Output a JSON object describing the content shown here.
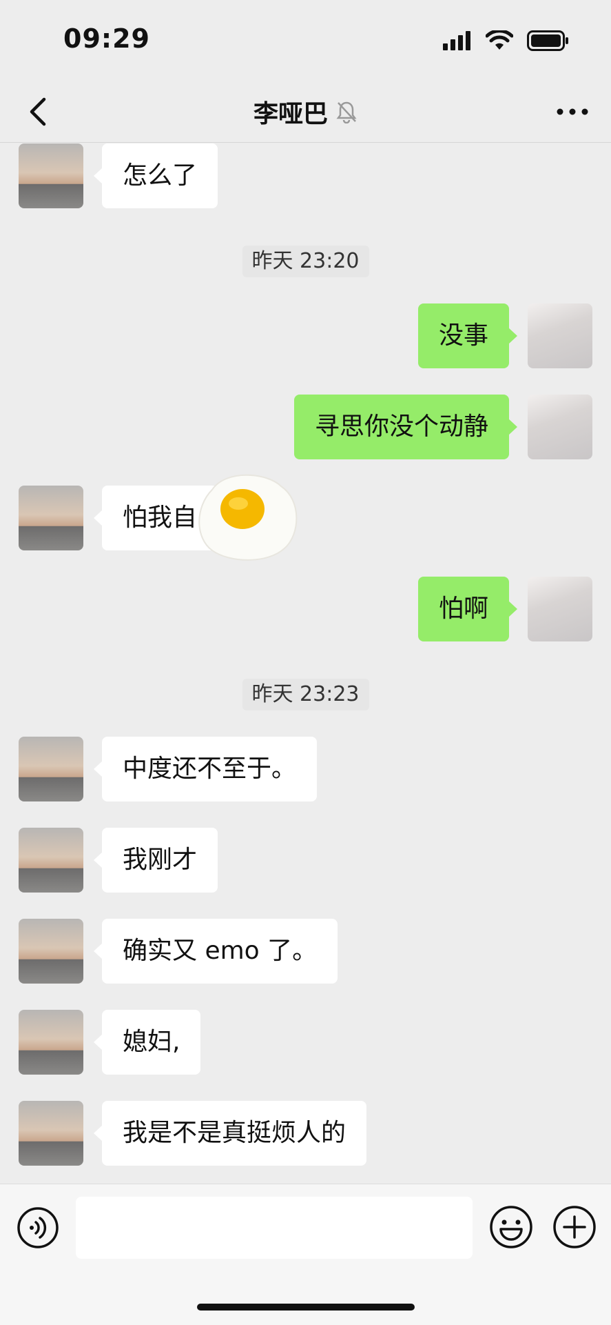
{
  "status_bar": {
    "time": "09:29",
    "icons": [
      "signal-icon",
      "wifi-icon",
      "battery-icon"
    ]
  },
  "nav": {
    "title": "李哑巴",
    "icons": [
      "back-icon",
      "mute-bell-icon",
      "more-icon"
    ]
  },
  "messages": [
    {
      "side": "left",
      "text": "怎么了"
    },
    {
      "timestamp": "昨天 23:20"
    },
    {
      "side": "right",
      "text": "没事"
    },
    {
      "side": "right",
      "text": "寻思你没个动静"
    },
    {
      "side": "left",
      "text": "怕我自"
    },
    {
      "side": "right",
      "text": "怕啊"
    },
    {
      "timestamp": "昨天 23:23"
    },
    {
      "side": "left",
      "text": "中度还不至于。"
    },
    {
      "side": "left",
      "text": "我刚才"
    },
    {
      "side": "left",
      "text": "确实又 emo 了。"
    },
    {
      "side": "left",
      "text": "媳妇,"
    },
    {
      "side": "left",
      "text": "我是不是真挺烦人的"
    }
  ],
  "overlay": {
    "sticker": "fried-egg-sticker"
  },
  "input_bar": {
    "placeholder": "",
    "icons": [
      "voice-icon",
      "emoji-icon",
      "plus-icon"
    ]
  },
  "colors": {
    "background": "#ededed",
    "bubble_mine": "#95ec69",
    "bubble_theirs": "#ffffff"
  }
}
